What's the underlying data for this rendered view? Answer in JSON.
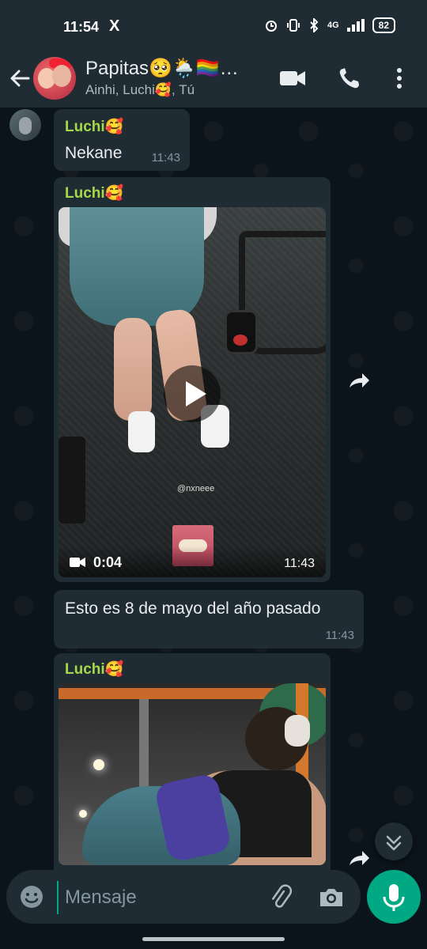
{
  "status_bar": {
    "time": "11:54",
    "app_icon": "X",
    "network": "4G",
    "battery": "82"
  },
  "header": {
    "title": "Papitas🥺🌦️🏳️‍🌈…",
    "subtitle": "Ainhi, Luchi🥰, Tú"
  },
  "messages": [
    {
      "sender": "Luchi🥰",
      "text": "Nekane",
      "time": "11:43"
    },
    {
      "sender": "Luchi🥰",
      "type": "video",
      "duration": "0:04",
      "time": "11:43",
      "watermark": "@nxneee"
    },
    {
      "text": "Esto es 8 de mayo del año pasado",
      "time": "11:43"
    },
    {
      "sender": "Luchi🥰",
      "type": "photo"
    }
  ],
  "composer": {
    "placeholder": "Mensaje"
  },
  "colors": {
    "accent": "#00a884",
    "sender_name": "#a5d84a",
    "bubble": "#202c33",
    "header_bg": "#1f2c34",
    "chat_bg": "#0b141a"
  }
}
